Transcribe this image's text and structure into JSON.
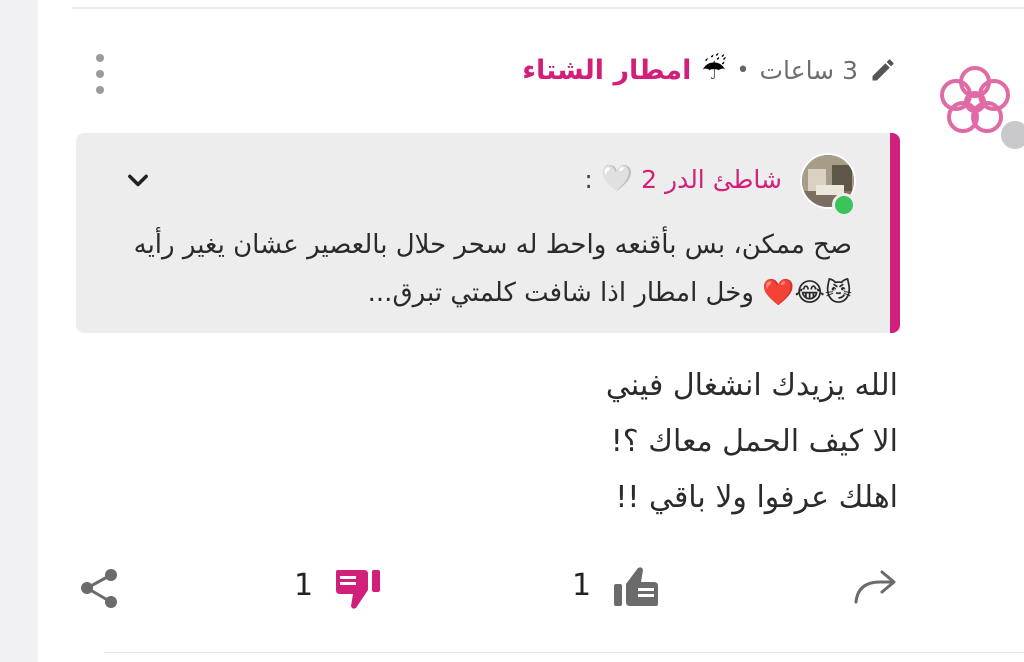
{
  "post": {
    "author": "امطار الشتاء",
    "author_emoji": "☔",
    "separator": "•",
    "time": "3 ساعات",
    "quote": {
      "author": "شاطئ الدر 2",
      "author_emoji": "🤍",
      "colon": ":",
      "text": "صح ممكن، بس بأقنعه واحط له سحر حلال بالعصير عشان يغير رأيه 😼😂❤️ وخل امطار اذا شافت كلمتي تبرق..."
    },
    "message_lines": [
      "الله يزيدك انشغال فيني",
      "الا كيف الحمل معاك ؟!",
      "اهلك عرفوا ولا باقي !!"
    ]
  },
  "actions": {
    "dislike_count": "1",
    "like_count": "1"
  },
  "icons": {
    "more": "more-vertical-icon",
    "edit": "pencil-icon",
    "expand": "chevron-down-icon",
    "share": "share-icon",
    "dislike": "thumbs-down-icon",
    "like": "thumbs-up-icon",
    "reply": "reply-arrow-icon"
  },
  "colors": {
    "accent": "#d2207a",
    "online": "#3ac45a",
    "offline": "#c9c9cc"
  }
}
